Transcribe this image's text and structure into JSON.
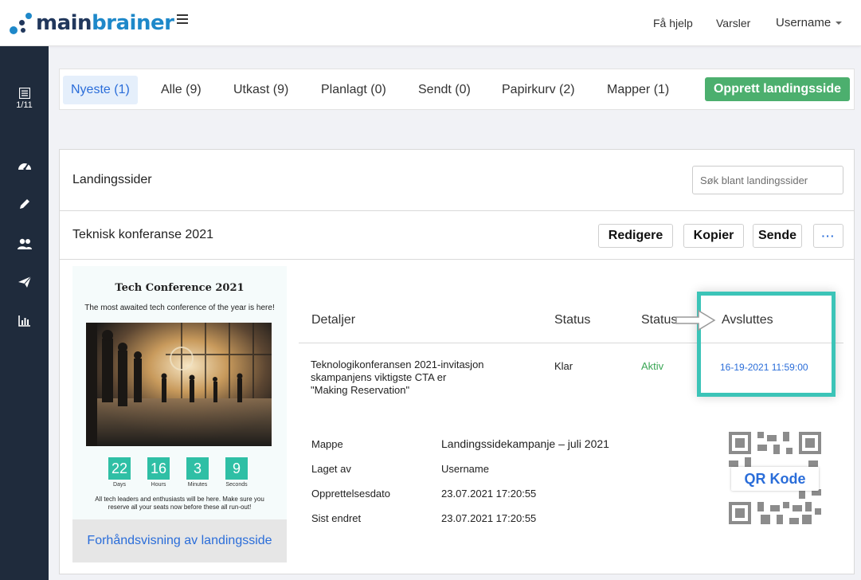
{
  "brand": {
    "part1": "main",
    "part2": "brainer"
  },
  "topnav": {
    "help": "Få hjelp",
    "alerts": "Varsler",
    "user": "Username"
  },
  "sidebar": {
    "counter": "1/11"
  },
  "tabs": [
    {
      "label": "Nyeste (1)",
      "active": true
    },
    {
      "label": "Alle (9)"
    },
    {
      "label": "Utkast (9)"
    },
    {
      "label": "Planlagt (0)"
    },
    {
      "label": "Sendt (0)"
    },
    {
      "label": "Papirkurv (2)"
    },
    {
      "label": "Mapper (1)"
    }
  ],
  "create_button": "Opprett landingsside",
  "panel": {
    "title": "Landingssider",
    "search_placeholder": "Søk blant landingssider"
  },
  "item": {
    "title": "Teknisk konferanse 2021",
    "actions": {
      "edit": "Redigere",
      "copy": "Kopier",
      "send": "Sende",
      "more": "···"
    }
  },
  "preview": {
    "title": "Tech Conference 2021",
    "subtitle": "The most awaited tech conference of the year is here!",
    "countdown": [
      {
        "value": "22",
        "label": "Days"
      },
      {
        "value": "16",
        "label": "Hours"
      },
      {
        "value": "3",
        "label": "Minutes"
      },
      {
        "value": "9",
        "label": "Seconds"
      }
    ],
    "footer": "All tech leaders and enthusiasts will be here. Make sure you reserve all your seats now before these all run-out!",
    "link": "Forhåndsvisning av landingsside"
  },
  "details": {
    "headers": {
      "details": "Detaljer",
      "status": "Status",
      "status2": "Status",
      "ends": "Avsluttes"
    },
    "row": {
      "line1": "Teknologikonferansen 2021-invitasjon",
      "line2": "skampanjens  viktigste CTA er",
      "line3": "\"Making Reservation\"",
      "status": "Klar",
      "status2": "Aktiv",
      "ends": "16-19-2021 11:59:00"
    }
  },
  "meta": [
    {
      "label": "Mappe",
      "value": "Landingssidekampanje – juli 2021"
    },
    {
      "label": "Laget av",
      "value": "Username"
    },
    {
      "label": "Opprettelsesdato",
      "value": "23.07.2021 17:20:55"
    },
    {
      "label": "Sist endret",
      "value": "23.07.2021 17:20:55"
    }
  ],
  "qr": {
    "label": "QR Kode"
  },
  "colors": {
    "accent": "#2a6dd9",
    "green": "#4caf6e",
    "teal": "#3cc4b8",
    "status_active": "#3aa655",
    "sidebar": "#1f2b3c"
  },
  "icons": [
    "logo-icon",
    "menu-icon",
    "list-icon",
    "dashboard-icon",
    "pencil-icon",
    "users-icon",
    "send-icon",
    "chart-icon",
    "arrow-icon",
    "qr-code-icon"
  ]
}
